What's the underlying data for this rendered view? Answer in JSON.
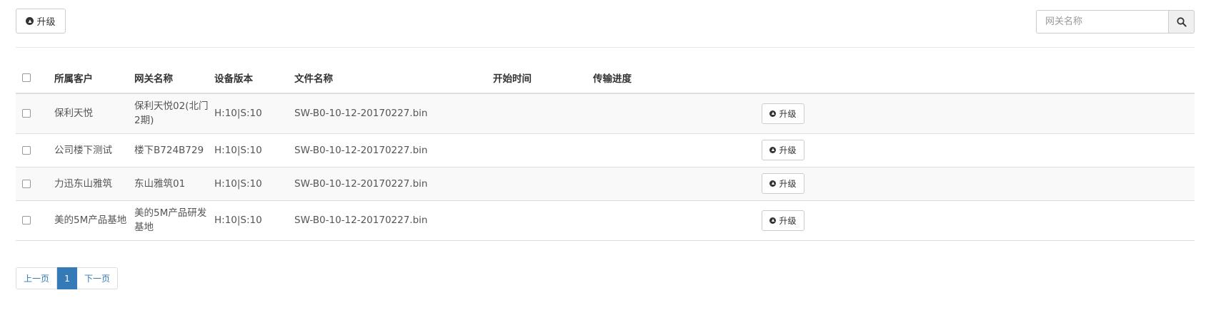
{
  "toolbar": {
    "upgrade_label": "升级",
    "upgrade_icon": "arrow-up-circle-icon"
  },
  "search": {
    "placeholder": "网关名称",
    "icon": "search-icon"
  },
  "table": {
    "headers": [
      "",
      "所属客户",
      "网关名称",
      "设备版本",
      "文件名称",
      "开始时间",
      "传输进度",
      ""
    ],
    "rows": [
      {
        "customer": "保利天悦",
        "gateway": "保利天悦02(北门2期)",
        "version": "H:10|S:10",
        "file": "SW-B0-10-12-20170227.bin",
        "start_time": "",
        "progress": "",
        "action": "升级"
      },
      {
        "customer": "公司楼下测试",
        "gateway": "楼下B724B729",
        "version": "H:10|S:10",
        "file": "SW-B0-10-12-20170227.bin",
        "start_time": "",
        "progress": "",
        "action": "升级"
      },
      {
        "customer": "力迅东山雅筑",
        "gateway": "东山雅筑01",
        "version": "H:10|S:10",
        "file": "SW-B0-10-12-20170227.bin",
        "start_time": "",
        "progress": "",
        "action": "升级"
      },
      {
        "customer": "美的5M产品基地",
        "gateway": "美的5M产品研发基地",
        "version": "H:10|S:10",
        "file": "SW-B0-10-12-20170227.bin",
        "start_time": "",
        "progress": "",
        "action": "升级"
      }
    ]
  },
  "pagination": {
    "prev": "上一页",
    "current": "1",
    "next": "下一页"
  },
  "colors": {
    "accent": "#337ab7",
    "border": "#dddddd",
    "stripe": "#f9f9f9"
  }
}
